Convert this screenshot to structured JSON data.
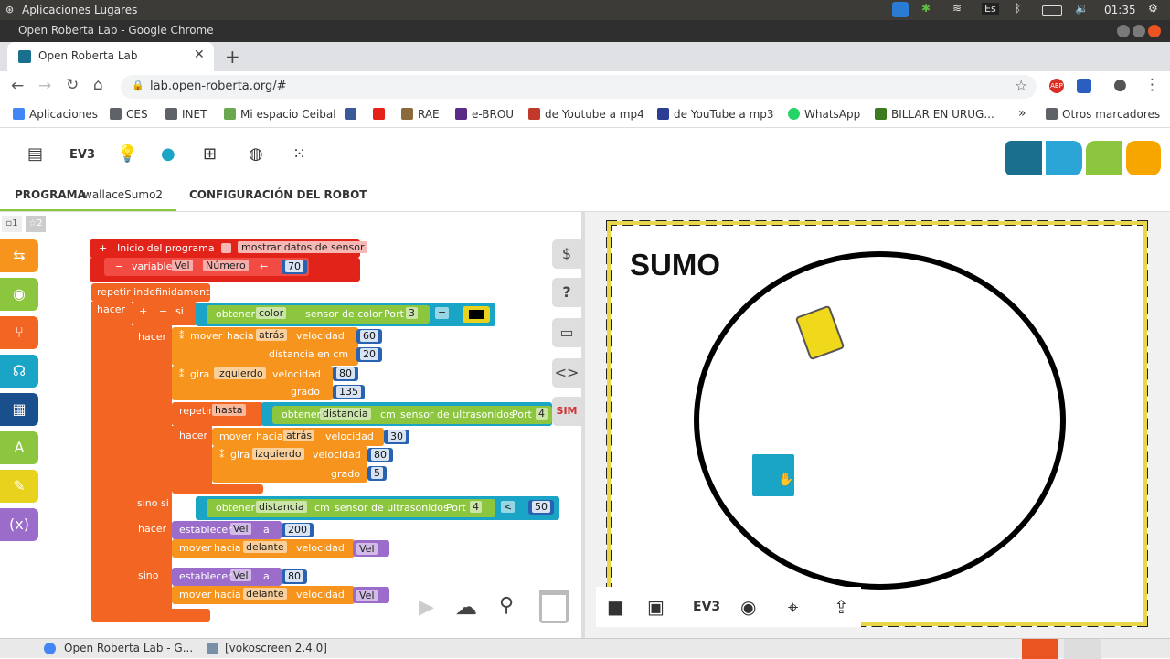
{
  "os": {
    "menu_apps": "Aplicaciones",
    "menu_places": "Lugares",
    "lang": "Es",
    "clock": "01:35"
  },
  "window": {
    "title": "Open Roberta Lab - Google Chrome"
  },
  "browser": {
    "tab_title": "Open Roberta Lab",
    "url": "lab.open-roberta.org/#",
    "bookmarks": [
      {
        "label": "Aplicaciones",
        "color": "#4285f4"
      },
      {
        "label": "CES",
        "color": "#5f6368"
      },
      {
        "label": "INET",
        "color": "#5f6368"
      },
      {
        "label": "Mi espacio Ceibal",
        "color": "#6aa84f"
      },
      {
        "label": "",
        "color": "#3b5998"
      },
      {
        "label": "",
        "color": "#e62117"
      },
      {
        "label": "RAE",
        "color": "#8b6b3d"
      },
      {
        "label": "e-BROU",
        "color": "#5b2a86"
      },
      {
        "label": "de Youtube a mp4",
        "color": "#c0392b"
      },
      {
        "label": "de YouTube a mp3",
        "color": "#2c3e91"
      },
      {
        "label": "WhatsApp",
        "color": "#25d366"
      },
      {
        "label": "BILLAR EN URUG...",
        "color": "#3b7a1e"
      }
    ],
    "more": "»",
    "other_bookmarks": "Otros marcadores"
  },
  "app": {
    "tab_program": "PROGRAMA",
    "program_name": "wallaceSumo2",
    "tab_config": "CONFIGURACIÓN DEL ROBOT",
    "ev3_label": "EV3",
    "slot1": "1",
    "slot2": "2",
    "logo_colors": [
      "#1a6f8e",
      "#2aa5d6",
      "#8cc63f",
      "#f7a600"
    ]
  },
  "blocks": {
    "start": "Inicio del programa",
    "show_sensor": "mostrar datos de sensor",
    "variable": "variable",
    "var_name": "Vel",
    "var_type": "Número",
    "arrow": "←",
    "init_value": "70",
    "repeat_forever": "repetir indefinidamente",
    "do": "hacer",
    "plus": "+",
    "minus": "−",
    "if": "si",
    "get": "obtener",
    "color": "color",
    "color_sensor": "sensor de color",
    "port": "Port",
    "port3": "3",
    "eq": "=",
    "move": "mover",
    "toward": "hacia",
    "back": "atrás",
    "speed": "velocidad",
    "speed60": "60",
    "distance_cm": "distancia en cm",
    "dist20": "20",
    "turn": "gira",
    "left": "izquierdo",
    "speed80": "80",
    "degrees": "grado",
    "deg135": "135",
    "repeat": "repetir",
    "until": "hasta",
    "distance": "distancia",
    "cm": "cm",
    "ultrasonic": "sensor de ultrasonidos",
    "port4": "4",
    "speed30": "30",
    "deg5": "5",
    "elseif": "sino si",
    "lt": "<",
    "v50": "50",
    "set": "establecer",
    "a": "a",
    "v200": "200",
    "forward": "delante",
    "else": "sino",
    "v80": "80"
  },
  "sidetools": {
    "sim": "SIM"
  },
  "sim": {
    "title": "SUMO",
    "bottom_ev3": "EV3"
  },
  "taskbar": {
    "item1": "Open Roberta Lab - G...",
    "item2": "[vokoscreen 2.4.0]"
  }
}
